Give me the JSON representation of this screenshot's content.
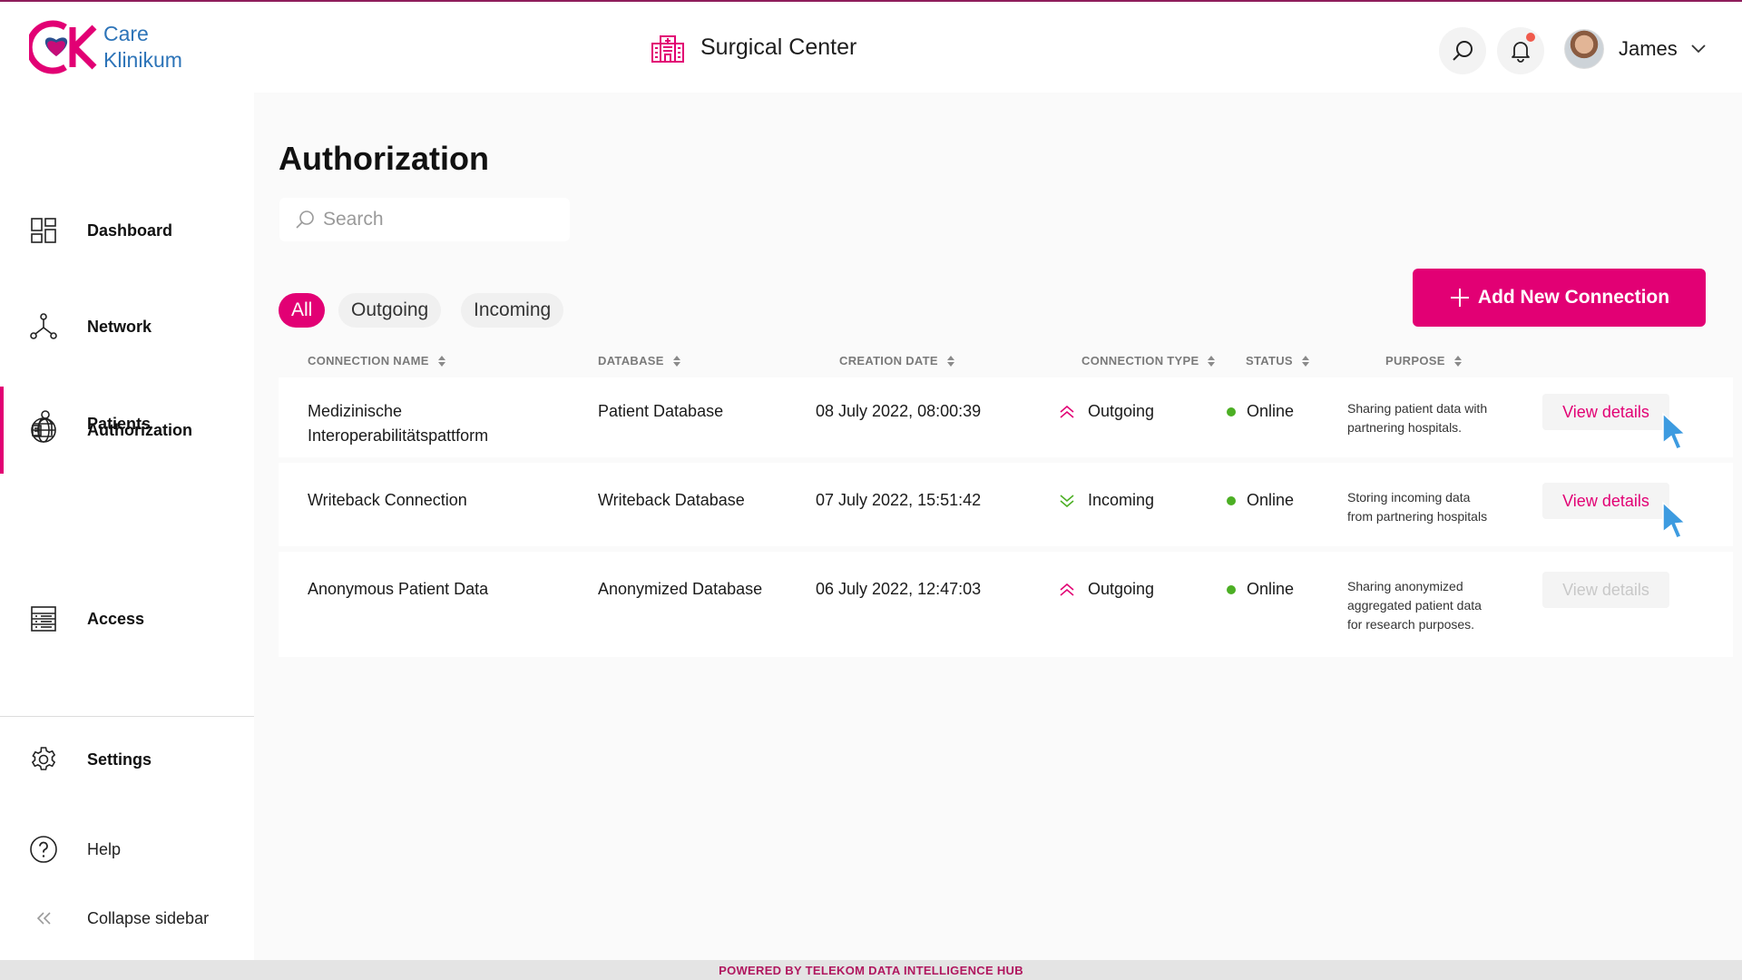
{
  "brand": {
    "line1": "Care",
    "line2": "Klinikum",
    "logo_letters": "CK",
    "colors": {
      "primary": "#e20074",
      "logo_blue": "#2d74b8"
    }
  },
  "header": {
    "facility_name": "Surgical Center",
    "user_name": "James",
    "has_notification": true
  },
  "sidebar": {
    "items": [
      {
        "label": "Dashboard",
        "icon": "dashboard-icon",
        "active": false
      },
      {
        "label": "Network",
        "icon": "network-icon",
        "active": false
      },
      {
        "label": "Patients",
        "icon": "patients-icon",
        "active": false
      },
      {
        "label": "Authorization",
        "icon": "globe-icon",
        "active": true
      },
      {
        "label": "Access",
        "icon": "server-icon",
        "active": false
      }
    ],
    "bottom_items": [
      {
        "label": "Settings",
        "icon": "gear-icon"
      },
      {
        "label": "Help",
        "icon": "help-icon"
      },
      {
        "label": "Collapse sidebar",
        "icon": "collapse-icon"
      }
    ]
  },
  "main": {
    "title": "Authorization",
    "search": {
      "placeholder": "Search",
      "value": ""
    },
    "filters": [
      {
        "label": "All",
        "active": true
      },
      {
        "label": "Outgoing",
        "active": false
      },
      {
        "label": "Incoming",
        "active": false
      }
    ],
    "add_button_label": "Add New Connection",
    "table": {
      "columns": [
        "CONNECTION NAME",
        "DATABASE",
        "CREATION DATE",
        "CONNECTION TYPE",
        "STATUS",
        "PURPOSE"
      ],
      "rows": [
        {
          "name_line1": "Medizinische",
          "name_line2": "Interoperabilitätspattform",
          "database": "Patient Database",
          "created": "08 July 2022, 08:00:39",
          "type": "Outgoing",
          "status": "Online",
          "purpose_line1": "Sharing patient data with",
          "purpose_line2": "partnering hospitals.",
          "purpose_line3": "",
          "action": "View details",
          "action_enabled": true
        },
        {
          "name_line1": "Writeback Connection",
          "name_line2": "",
          "database": "Writeback Database",
          "created": "07 July 2022, 15:51:42",
          "type": "Incoming",
          "status": "Online",
          "purpose_line1": "Storing incoming data",
          "purpose_line2": "from partnering hospitals",
          "purpose_line3": "",
          "action": "View details",
          "action_enabled": true
        },
        {
          "name_line1": "Anonymous Patient Data",
          "name_line2": "",
          "database": "Anonymized Database",
          "created": "06 July 2022, 12:47:03",
          "type": "Outgoing",
          "status": "Online",
          "purpose_line1": "Sharing anonymized",
          "purpose_line2": "aggregated patient data",
          "purpose_line3": "for research purposes.",
          "action": "View details",
          "action_enabled": false
        }
      ]
    }
  },
  "footer": {
    "text": "POWERED BY TELEKOM DATA INTELLIGENCE HUB"
  }
}
